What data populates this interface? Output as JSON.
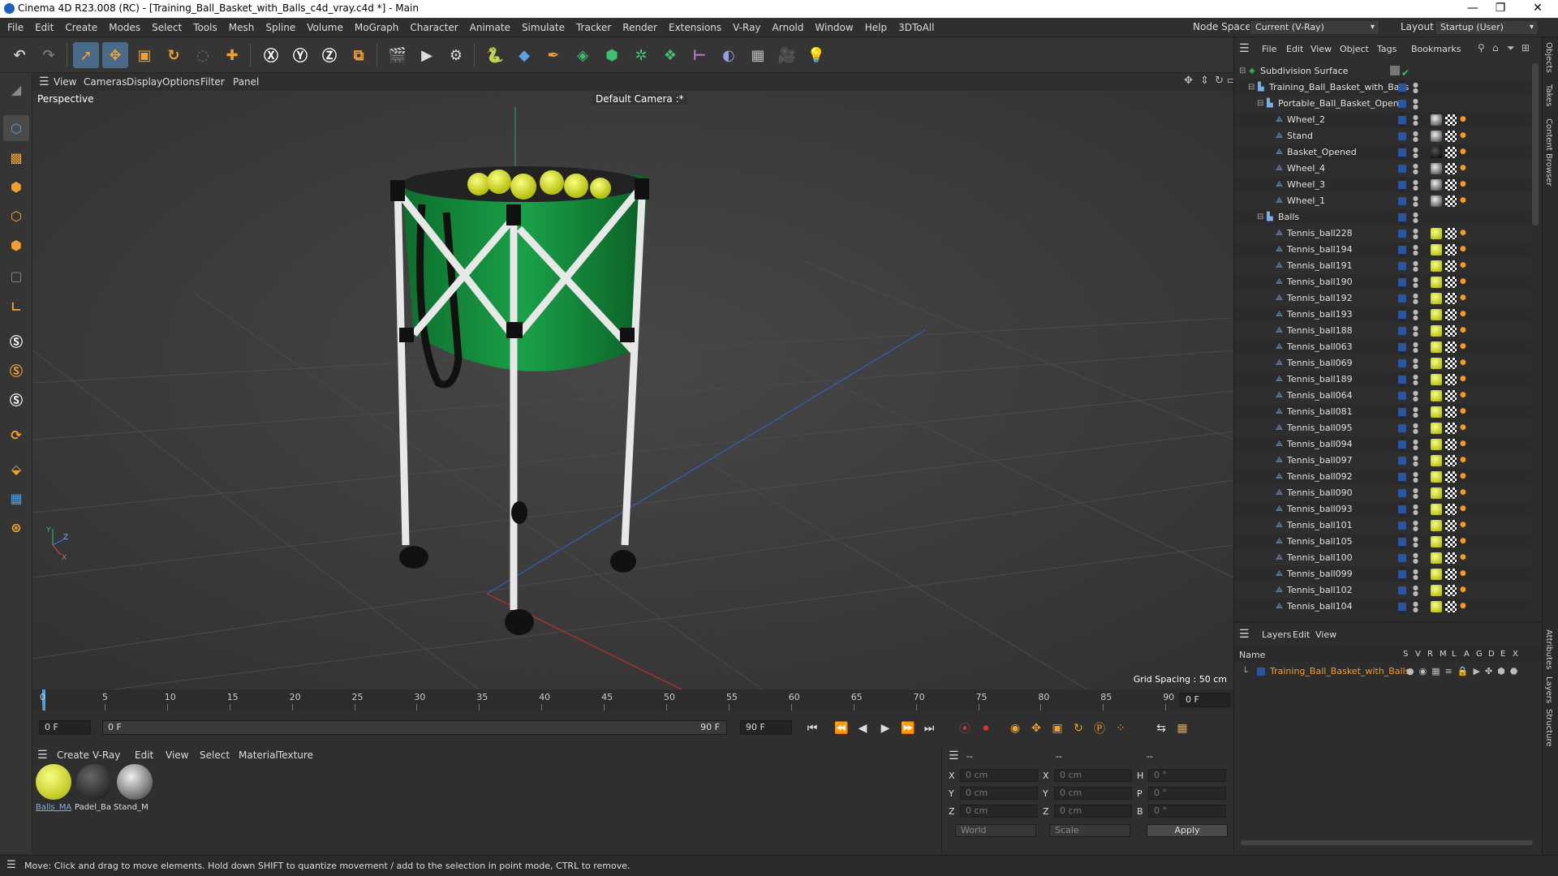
{
  "window": {
    "title": "Cinema 4D R23.008 (RC) - [Training_Ball_Basket_with_Balls_c4d_vray.c4d *] - Main",
    "min": "—",
    "max": "❐",
    "close": "✕"
  },
  "menu": [
    "File",
    "Edit",
    "Create",
    "Modes",
    "Select",
    "Tools",
    "Mesh",
    "Spline",
    "Volume",
    "MoGraph",
    "Character",
    "Animate",
    "Simulate",
    "Tracker",
    "Render",
    "Extensions",
    "V-Ray",
    "Arnold",
    "Window",
    "Help",
    "3DToAll"
  ],
  "nodespace": {
    "label": "Node Space:",
    "value": "Current (V-Ray)"
  },
  "layout": {
    "label": "Layout:",
    "value": "Startup (User)"
  },
  "viewport": {
    "menu": [
      "View",
      "Cameras",
      "Display",
      "Options",
      "Filter",
      "Panel"
    ],
    "label": "Perspective",
    "camera": "Default Camera :*",
    "grid": "Grid Spacing : 50 cm"
  },
  "timeline": {
    "ticks": [
      "0",
      "5",
      "10",
      "15",
      "20",
      "25",
      "30",
      "35",
      "40",
      "45",
      "50",
      "55",
      "60",
      "65",
      "70",
      "75",
      "80",
      "85",
      "90"
    ],
    "current": "0 F",
    "end_right": "0 F"
  },
  "transport": {
    "start": "0 F",
    "range_start": "0 F",
    "range_end": "90 F",
    "end": "90 F"
  },
  "materials": {
    "menu": [
      "Create",
      "V-Ray",
      "Edit",
      "View",
      "Select",
      "Material",
      "Texture"
    ],
    "items": [
      "Balls_MA",
      "Padel_Ba",
      "Stand_M"
    ]
  },
  "attributes": {
    "header": "--",
    "header2": "--",
    "header3": "--",
    "x": "X",
    "y": "Y",
    "z": "Z",
    "h": "H",
    "p": "P",
    "b": "B",
    "pos_x": "0 cm",
    "pos_y": "0 cm",
    "pos_z": "0 cm",
    "sz_x": "0 cm",
    "sz_y": "0 cm",
    "sz_z": "0 cm",
    "rot_h": "0 °",
    "rot_p": "0 °",
    "rot_b": "0 °",
    "coord": "World",
    "mode": "Scale",
    "apply": "Apply"
  },
  "status": "Move: Click and drag to move elements. Hold down SHIFT to quantize movement / add to the selection in point mode, CTRL to remove.",
  "objects": {
    "menu": [
      "File",
      "Edit",
      "View",
      "Object",
      "Tags",
      "Bookmarks"
    ],
    "rows": [
      {
        "name": "Subdivision Surface",
        "indent": 0,
        "kind": "sub"
      },
      {
        "name": "Training_Ball_Basket_with_Balls",
        "indent": 1,
        "kind": "null"
      },
      {
        "name": "Portable_Ball_Basket_Open",
        "indent": 2,
        "kind": "null"
      },
      {
        "name": "Wheel_2",
        "indent": 3,
        "kind": "obj",
        "mat": "dark"
      },
      {
        "name": "Stand",
        "indent": 3,
        "kind": "obj",
        "mat": "dark"
      },
      {
        "name": "Basket_Opened",
        "indent": 3,
        "kind": "obj",
        "mat": "black"
      },
      {
        "name": "Wheel_4",
        "indent": 3,
        "kind": "obj",
        "mat": "dark"
      },
      {
        "name": "Wheel_3",
        "indent": 3,
        "kind": "obj",
        "mat": "dark"
      },
      {
        "name": "Wheel_1",
        "indent": 3,
        "kind": "obj",
        "mat": "dark"
      },
      {
        "name": "Balls",
        "indent": 2,
        "kind": "null"
      },
      {
        "name": "Tennis_ball228",
        "indent": 3,
        "kind": "obj",
        "mat": "ball"
      },
      {
        "name": "Tennis_ball194",
        "indent": 3,
        "kind": "obj",
        "mat": "ball"
      },
      {
        "name": "Tennis_ball191",
        "indent": 3,
        "kind": "obj",
        "mat": "ball"
      },
      {
        "name": "Tennis_ball190",
        "indent": 3,
        "kind": "obj",
        "mat": "ball"
      },
      {
        "name": "Tennis_ball192",
        "indent": 3,
        "kind": "obj",
        "mat": "ball"
      },
      {
        "name": "Tennis_ball193",
        "indent": 3,
        "kind": "obj",
        "mat": "ball"
      },
      {
        "name": "Tennis_ball188",
        "indent": 3,
        "kind": "obj",
        "mat": "ball"
      },
      {
        "name": "Tennis_ball063",
        "indent": 3,
        "kind": "obj",
        "mat": "ball"
      },
      {
        "name": "Tennis_ball069",
        "indent": 3,
        "kind": "obj",
        "mat": "ball"
      },
      {
        "name": "Tennis_ball189",
        "indent": 3,
        "kind": "obj",
        "mat": "ball"
      },
      {
        "name": "Tennis_ball064",
        "indent": 3,
        "kind": "obj",
        "mat": "ball"
      },
      {
        "name": "Tennis_ball081",
        "indent": 3,
        "kind": "obj",
        "mat": "ball"
      },
      {
        "name": "Tennis_ball095",
        "indent": 3,
        "kind": "obj",
        "mat": "ball"
      },
      {
        "name": "Tennis_ball094",
        "indent": 3,
        "kind": "obj",
        "mat": "ball"
      },
      {
        "name": "Tennis_ball097",
        "indent": 3,
        "kind": "obj",
        "mat": "ball"
      },
      {
        "name": "Tennis_ball092",
        "indent": 3,
        "kind": "obj",
        "mat": "ball"
      },
      {
        "name": "Tennis_ball090",
        "indent": 3,
        "kind": "obj",
        "mat": "ball"
      },
      {
        "name": "Tennis_ball093",
        "indent": 3,
        "kind": "obj",
        "mat": "ball"
      },
      {
        "name": "Tennis_ball101",
        "indent": 3,
        "kind": "obj",
        "mat": "ball"
      },
      {
        "name": "Tennis_ball105",
        "indent": 3,
        "kind": "obj",
        "mat": "ball"
      },
      {
        "name": "Tennis_ball100",
        "indent": 3,
        "kind": "obj",
        "mat": "ball"
      },
      {
        "name": "Tennis_ball099",
        "indent": 3,
        "kind": "obj",
        "mat": "ball"
      },
      {
        "name": "Tennis_ball102",
        "indent": 3,
        "kind": "obj",
        "mat": "ball"
      },
      {
        "name": "Tennis_ball104",
        "indent": 3,
        "kind": "obj",
        "mat": "ball"
      }
    ]
  },
  "layers": {
    "menu": [
      "Layers",
      "Edit",
      "View"
    ],
    "name_header": "Name",
    "cols": [
      "S",
      "V",
      "R",
      "M",
      "L",
      "A",
      "G",
      "D",
      "E",
      "X"
    ],
    "row": "Training_Ball_Basket_with_Balls"
  },
  "sidetabs": [
    "Objects",
    "Takes",
    "Content Browser",
    "Attributes",
    "Layers",
    "Structure"
  ],
  "colors": {
    "accent": "#4a6a8a",
    "layer_text": "#f59a23",
    "selection_blue": "#2a55a5"
  }
}
